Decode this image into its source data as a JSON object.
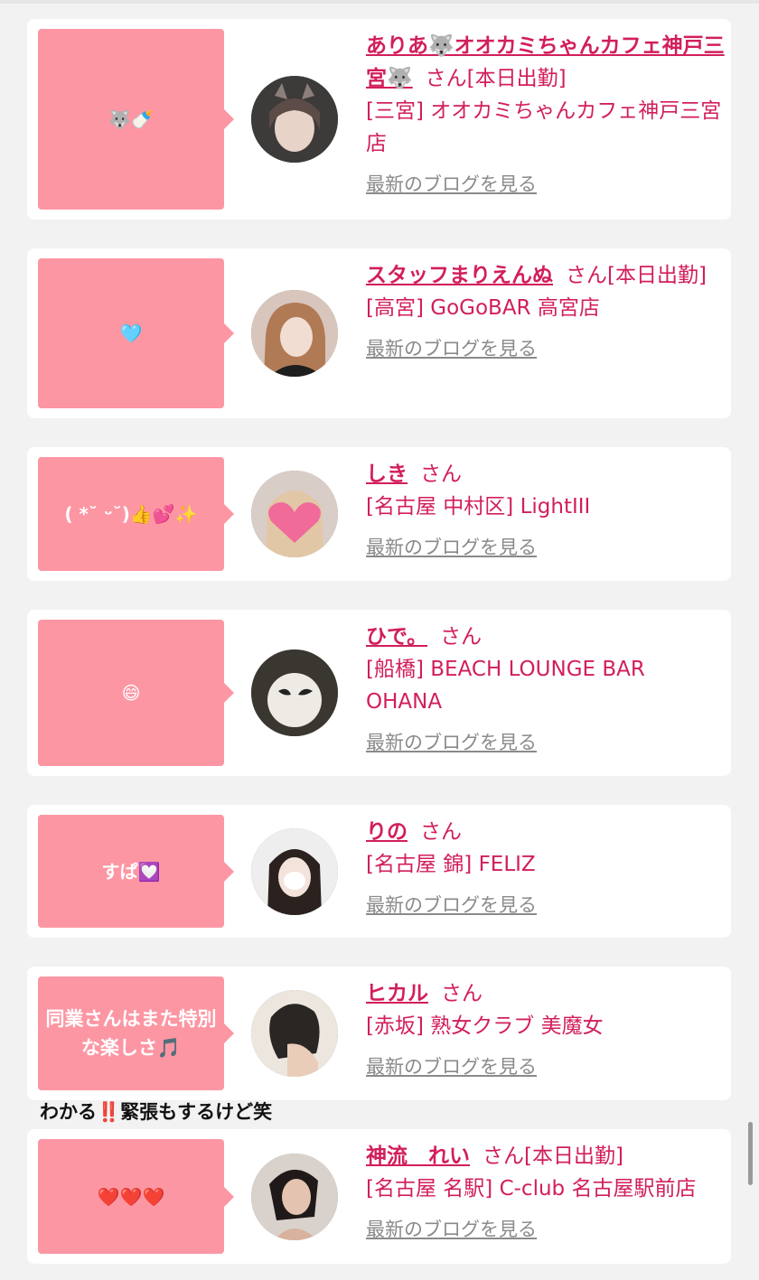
{
  "posts": [
    {
      "bubble": "🐺🍼",
      "name": "ありあ🐺オオカミちゃんカフェ神戸三宮🐺",
      "san": "さん[本日出勤]",
      "shop": "[三宮] オオカミちゃんカフェ神戸三宮店",
      "blog": "最新のブログを見る",
      "avatar_icon": "user-avatar-photo"
    },
    {
      "bubble": "🩵",
      "name": "スタッフまりえんぬ",
      "san": "さん[本日出勤]",
      "shop": "[高宮] GoGoBAR 高宮店",
      "blog": "最新のブログを見る",
      "avatar_icon": "user-avatar-photo"
    },
    {
      "bubble": "( *˘ ᵕ˘)👍💕✨",
      "name": "しき",
      "san": "さん",
      "shop": "[名古屋 中村区] LightIII",
      "blog": "最新のブログを見る",
      "avatar_icon": "user-avatar-photo"
    },
    {
      "bubble": "😄",
      "name": "ひで。",
      "san": "さん",
      "shop": "[船橋] BEACH LOUNGE BAR OHANA",
      "blog": "最新のブログを見る",
      "avatar_icon": "user-avatar-photo"
    },
    {
      "bubble": "すぱ💟",
      "name": "りの",
      "san": "さん",
      "shop": "[名古屋 錦] FELIZ",
      "blog": "最新のブログを見る",
      "avatar_icon": "user-avatar-photo"
    },
    {
      "bubble": "同業さんはまた特別な楽しさ🎵",
      "name": "ヒカル",
      "san": "さん",
      "shop": "[赤坂] 熟女クラブ 美魔女",
      "blog": "最新のブログを見る",
      "avatar_icon": "user-avatar-photo"
    },
    {
      "bubble": "❤️❤️❤️",
      "name": "神流　れい",
      "san": "さん[本日出勤]",
      "shop": "[名古屋 名駅] C-club 名古屋駅前店",
      "blog": "最新のブログを見る",
      "avatar_icon": "user-avatar-photo"
    }
  ],
  "overflow_text": "わかる‼️緊張もするけど笑",
  "colors": {
    "bubble": "#fd96a3",
    "accent": "#d21e5c",
    "link_gray": "#8a8a8a",
    "background": "#f2f2f2"
  }
}
